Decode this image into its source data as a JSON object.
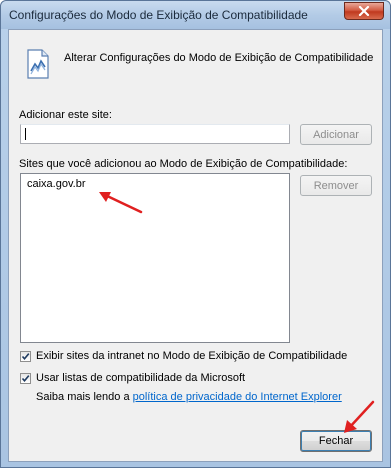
{
  "window": {
    "title": "Configurações do Modo de Exibição de Compatibilidade"
  },
  "header": {
    "text": "Alterar Configurações do Modo de Exibição de Compatibilidade",
    "icon": "compatibility-view-icon"
  },
  "add_site": {
    "label": "Adicionar este site:",
    "value": "",
    "button_label": "Adicionar"
  },
  "site_list": {
    "label": "Sites que você adicionou ao Modo de Exibição de Compatibilidade:",
    "items": [
      "caixa.gov.br"
    ],
    "remove_label": "Remover"
  },
  "options": {
    "intranet_label": "Exibir sites da intranet no Modo de Exibição de Compatibilidade",
    "intranet_checked": true,
    "microsoft_lists_label": "Usar listas de compatibilidade da Microsoft",
    "microsoft_lists_checked": true
  },
  "privacy": {
    "prefix": "Saiba mais lendo a",
    "link_text": "política de privacidade do Internet Explorer"
  },
  "footer": {
    "close_label": "Fechar"
  },
  "colors": {
    "annotation_arrow": "#e02020",
    "link": "#0066cc"
  }
}
